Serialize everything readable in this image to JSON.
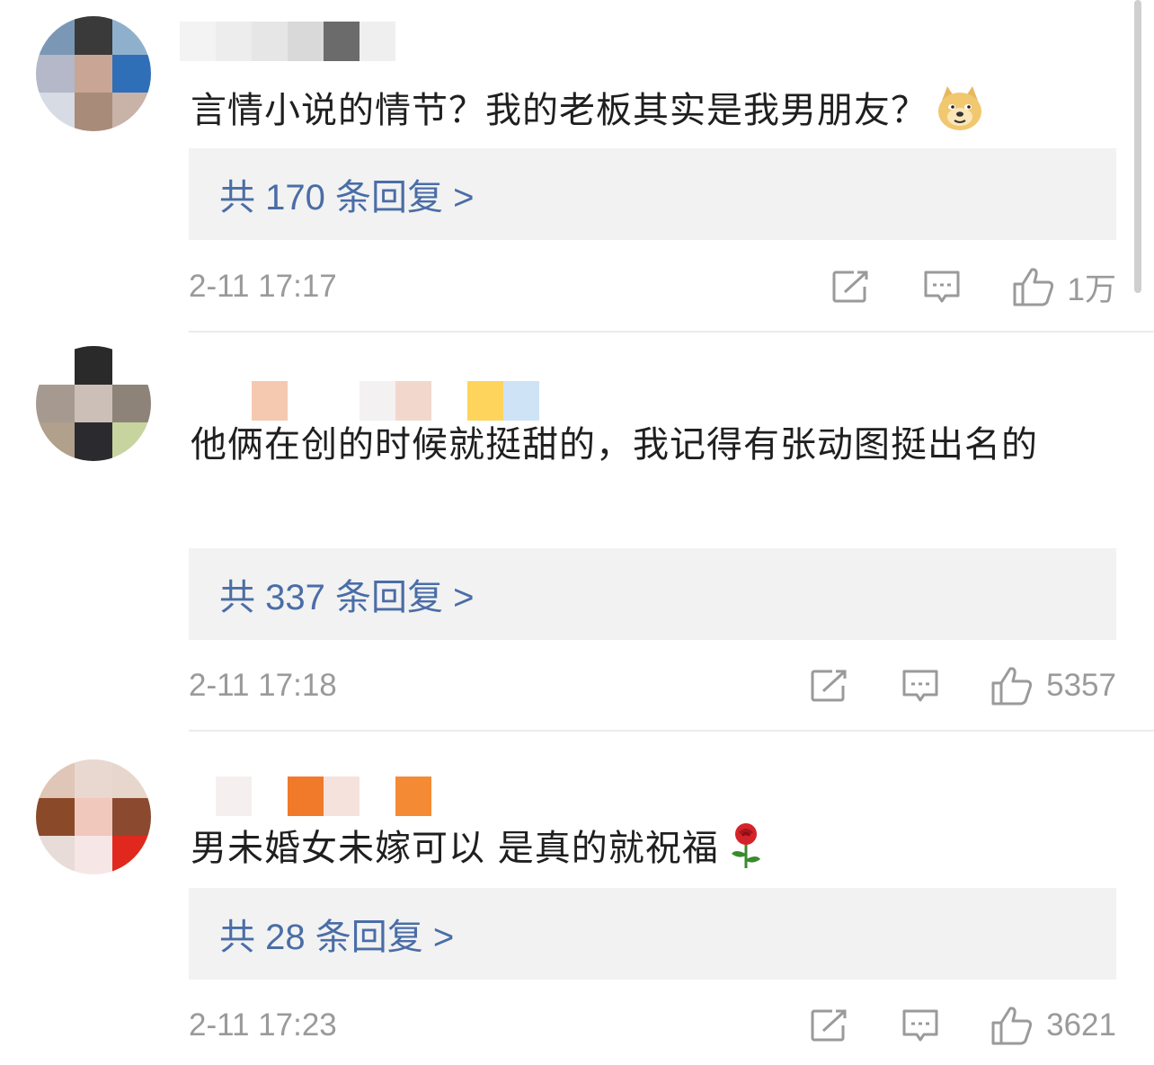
{
  "comments": [
    {
      "text": "言情小说的情节？我的老板其实是我男朋友？",
      "emoji": "doge-emoji",
      "replies_label": "共 170 条回复 >",
      "time": "2-11 17:17",
      "likes": "1万"
    },
    {
      "text": "他俩在创的时候就挺甜的，我记得有张动图挺出名的",
      "emoji": "",
      "replies_label": "共 337 条回复 >",
      "time": "2-11 17:18",
      "likes": "5357"
    },
    {
      "text": "男未婚女未嫁可以 是真的就祝福",
      "emoji": "rose-emoji",
      "replies_label": "共 28 条回复 >",
      "time": "2-11 17:23",
      "likes": "3621"
    }
  ],
  "icons": {
    "share": "share-icon",
    "comment": "comment-icon",
    "like": "thumbs-up-icon"
  },
  "colors": {
    "reply_link": "#4a6da7",
    "reply_box_bg": "#f2f2f2",
    "meta_text": "#9a9a9a",
    "body_text": "#1f1f1f"
  }
}
